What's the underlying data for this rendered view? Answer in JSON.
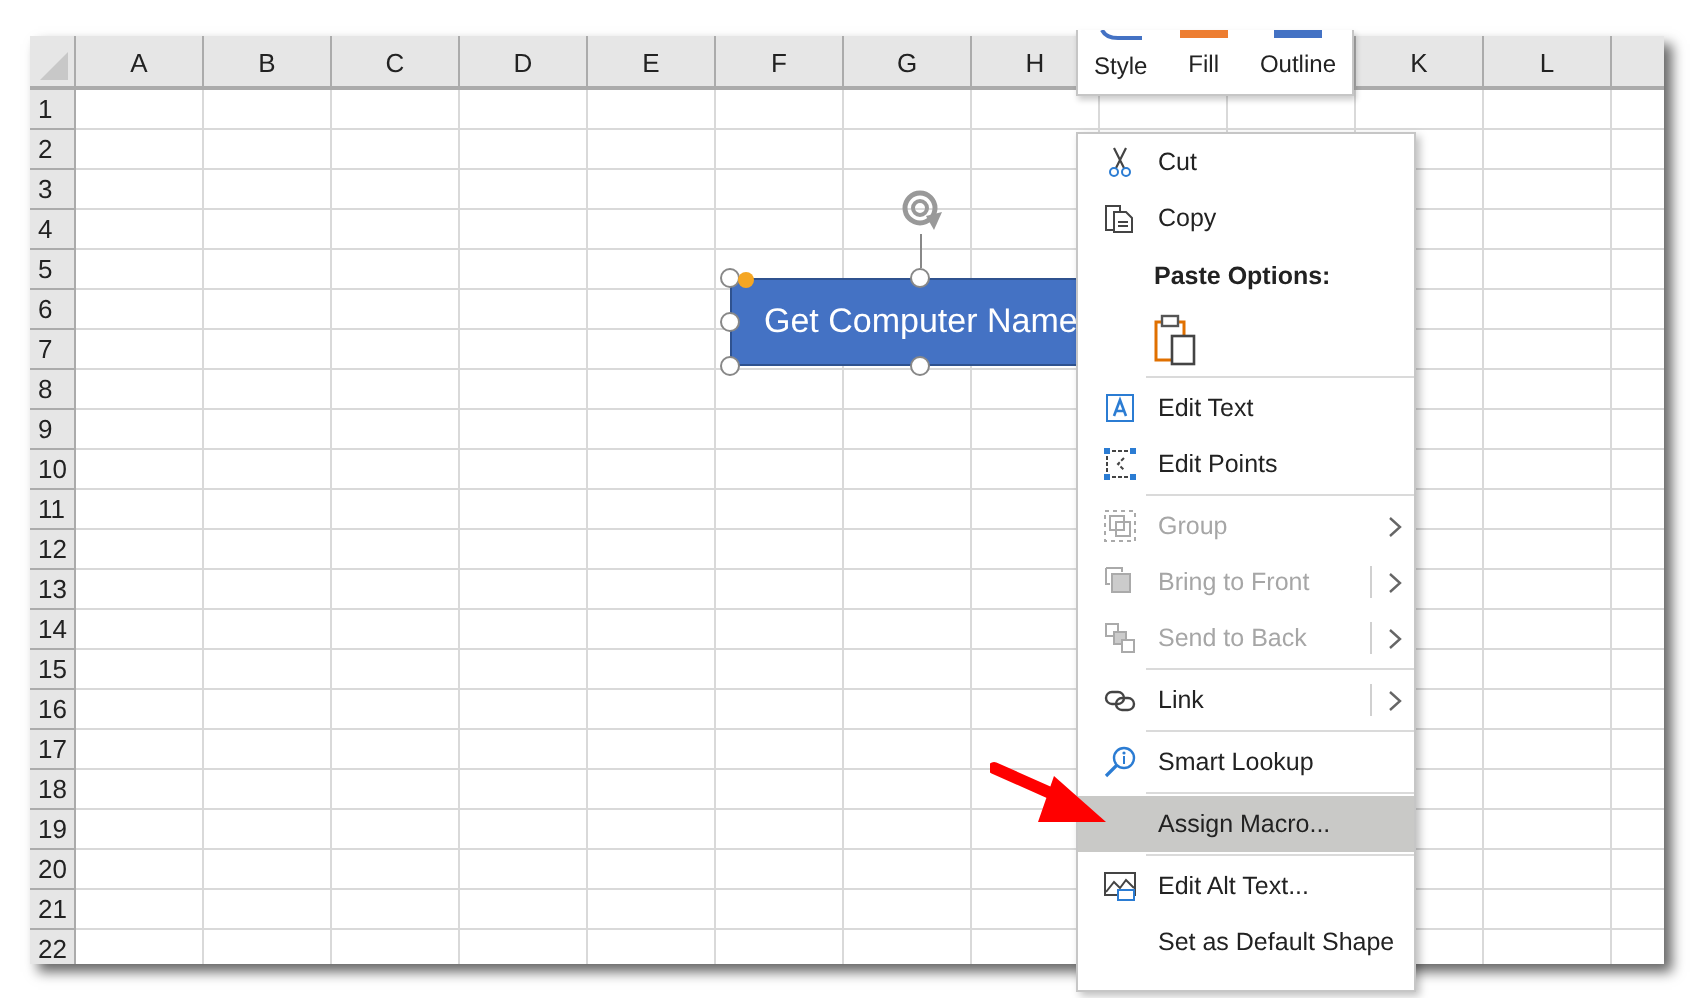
{
  "sheet": {
    "columns": [
      {
        "label": "A"
      },
      {
        "label": "B"
      },
      {
        "label": "C"
      },
      {
        "label": "D"
      },
      {
        "label": "E"
      },
      {
        "label": "F"
      },
      {
        "label": "G"
      },
      {
        "label": "H"
      },
      {},
      {},
      {
        "label": "K"
      },
      {
        "label": "L"
      },
      {}
    ],
    "rows": [
      "1",
      "2",
      "3",
      "4",
      "5",
      "6",
      "7",
      "8",
      "9",
      "10",
      "11",
      "12",
      "13",
      "14",
      "15",
      "16",
      "17",
      "18",
      "19",
      "20",
      "21",
      "22"
    ]
  },
  "shape": {
    "text": "Get Computer Name",
    "selected": true
  },
  "mini_toolbar": [
    {
      "label": "Style"
    },
    {
      "label": "Fill",
      "color": "#ed7d31"
    },
    {
      "label": "Outline",
      "color": "#4472c4"
    }
  ],
  "context_menu": [
    {
      "kind": "item",
      "label": "Cut",
      "disabled": false,
      "submenu": false,
      "split": false,
      "selected": false
    },
    {
      "kind": "item",
      "label": "Copy",
      "disabled": false,
      "submenu": false,
      "split": false,
      "selected": false
    },
    {
      "kind": "header",
      "label": "Paste Options:"
    },
    {
      "kind": "paste"
    },
    {
      "kind": "separator"
    },
    {
      "kind": "item",
      "label": "Edit Text",
      "disabled": false,
      "submenu": false,
      "split": false,
      "selected": false
    },
    {
      "kind": "item",
      "label": "Edit Points",
      "disabled": false,
      "submenu": false,
      "split": false,
      "selected": false
    },
    {
      "kind": "separator"
    },
    {
      "kind": "item",
      "label": "Group",
      "disabled": true,
      "submenu": true,
      "split": false,
      "selected": false
    },
    {
      "kind": "item",
      "label": "Bring to Front",
      "disabled": true,
      "submenu": true,
      "split": true,
      "selected": false
    },
    {
      "kind": "item",
      "label": "Send to Back",
      "disabled": true,
      "submenu": true,
      "split": true,
      "selected": false
    },
    {
      "kind": "separator"
    },
    {
      "kind": "item",
      "label": "Link",
      "disabled": false,
      "submenu": true,
      "split": true,
      "selected": false
    },
    {
      "kind": "separator"
    },
    {
      "kind": "item",
      "label": "Smart Lookup",
      "disabled": false,
      "submenu": false,
      "split": false,
      "selected": false
    },
    {
      "kind": "separator"
    },
    {
      "kind": "item",
      "label": "Assign Macro...",
      "disabled": false,
      "submenu": false,
      "split": false,
      "selected": true
    },
    {
      "kind": "separator"
    },
    {
      "kind": "item",
      "label": "Edit Alt Text...",
      "disabled": false,
      "submenu": false,
      "split": false,
      "selected": false
    },
    {
      "kind": "item",
      "label": "Set as Default Shape",
      "disabled": false,
      "submenu": false,
      "split": false,
      "selected": false
    }
  ]
}
